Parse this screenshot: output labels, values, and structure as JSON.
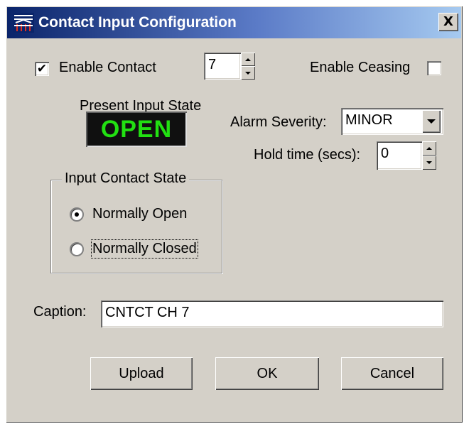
{
  "window": {
    "title": "Contact Input Configuration",
    "close_label": "X"
  },
  "enable_contact": {
    "label": "Enable Contact",
    "checked": true,
    "check_mark": "✔"
  },
  "contact_number": {
    "value": "7"
  },
  "enable_ceasing": {
    "label": "Enable Ceasing",
    "checked": false
  },
  "present_state": {
    "label": "Present Input State",
    "value": "OPEN",
    "color": "#22e012"
  },
  "alarm_severity": {
    "label": "Alarm Severity:",
    "selected": "MINOR"
  },
  "hold_time": {
    "label": "Hold time (secs):",
    "value": "0"
  },
  "input_contact_state": {
    "title": "Input Contact State",
    "options": [
      {
        "label": "Normally Open",
        "selected": true
      },
      {
        "label": "Normally Closed",
        "selected": false
      }
    ]
  },
  "caption": {
    "label": "Caption:",
    "value": "CNTCT CH 7"
  },
  "buttons": {
    "upload": "Upload",
    "ok": "OK",
    "cancel": "Cancel"
  }
}
